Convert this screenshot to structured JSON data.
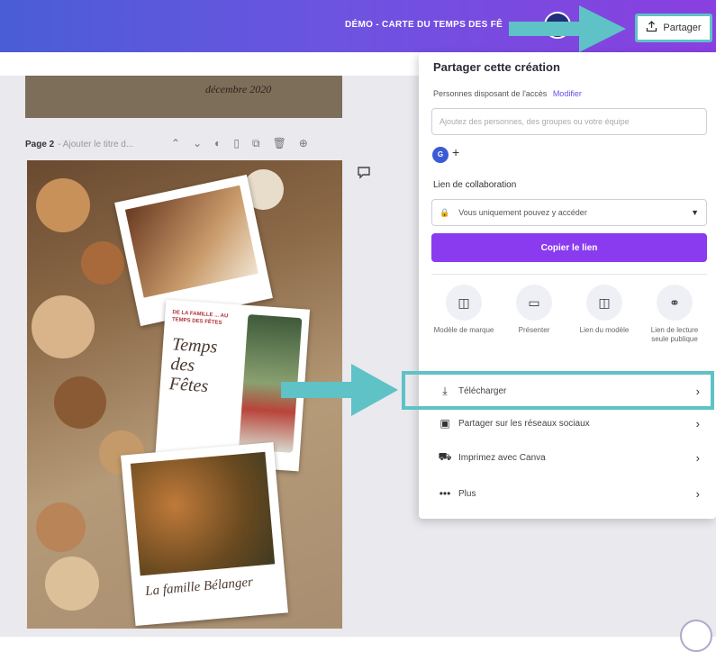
{
  "header": {
    "doc_title": "DÉMO - CARTE DU TEMPS DES FÊ",
    "share_label": "Partager"
  },
  "canvas": {
    "page1_text": "décembre 2020",
    "page2_label": "Page 2",
    "page2_hint": "- Ajouter le titre d...",
    "card_header": "DE LA FAMILLE ... AU TEMPS DES FÊTES",
    "card_title": "Temps des Fêtes",
    "signature": "La famille Bélanger"
  },
  "share_panel": {
    "title": "Partager cette création",
    "permissions_text": "Personnes disposant de l'accès",
    "permissions_link": "Modifier",
    "people_placeholder": "Ajoutez des personnes, des groupes ou votre équipe",
    "user_initials": "G",
    "add_people": "+",
    "collab_label": "Lien de collaboration",
    "collab_value": "Vous uniquement pouvez y accéder",
    "copy_button": "Copier le lien",
    "shortcuts": [
      {
        "label": "Modèle de marque",
        "icon": "template-icon"
      },
      {
        "label": "Présenter",
        "icon": "present-icon"
      },
      {
        "label": "Lien du modèle",
        "icon": "template-link-icon"
      },
      {
        "label": "Lien de lecture seule publique",
        "icon": "view-link-icon"
      }
    ],
    "options": [
      {
        "label": "Télécharger",
        "icon": "download-icon"
      },
      {
        "label": "Partager sur les réseaux sociaux",
        "icon": "social-icon"
      },
      {
        "label": "Imprimez avec Canva",
        "icon": "print-icon"
      },
      {
        "label": "Plus",
        "icon": "more-icon"
      }
    ]
  },
  "colors": {
    "topbar_start": "#4a5dd6",
    "topbar_end": "#8a3fe0",
    "primary_button": "#8a3bef",
    "annotation": "#5ec2c6"
  }
}
